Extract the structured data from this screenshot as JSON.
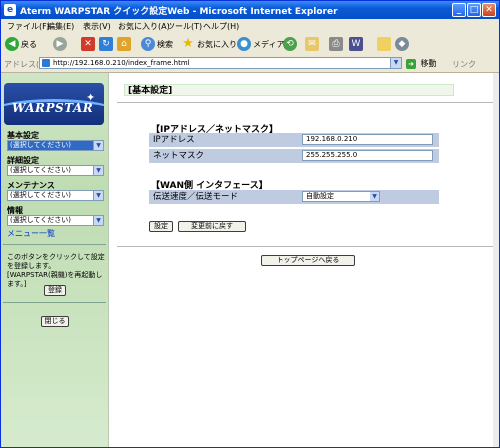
{
  "window": {
    "title": "Aterm WARPSTAR クイック設定Web - Microsoft Internet Explorer",
    "app_icon": "e",
    "minimize": "_",
    "maximize": "□",
    "close": "✕"
  },
  "menu": [
    "ファイル(F)",
    "編集(E)",
    "表示(V)",
    "お気に入り(A)",
    "ツール(T)",
    "ヘルプ(H)"
  ],
  "toolbar": {
    "back": "戻る",
    "search": "検索",
    "favorites": "お気に入り",
    "media": "メディア"
  },
  "address": {
    "label": "アドレス(D)",
    "url": "http://192.168.0.210/index_frame.html",
    "go": "移動",
    "links": "リンク"
  },
  "sidebar": {
    "logo": "WARPSTAR",
    "categories": [
      {
        "label": "基本設定",
        "select": "(選択してください)"
      },
      {
        "label": "詳細設定",
        "select": "(選択してください)"
      },
      {
        "label": "メンテナンス",
        "select": "(選択してください)"
      },
      {
        "label": "情報",
        "select": "(選択してください)"
      }
    ],
    "menu_list": "メニュー一覧",
    "note": "このボタンをクリックして設定を登録します。[WARPSTAR(親機)を再起動します。]",
    "register_button": "登録",
    "close_button": "閉じる"
  },
  "main": {
    "heading": "[基本設定]",
    "ip_section": "【IPアドレス／ネットマスク】",
    "ip_label": "IPアドレス",
    "ip_value": "192.168.0.210",
    "mask_label": "ネットマスク",
    "mask_value": "255.255.255.0",
    "wan_section": "【WAN側 インタフェース】",
    "speed_label": "伝送速度／伝送モード",
    "speed_value": "自動設定",
    "set_button": "設定",
    "revert_button": "変更前に戻す",
    "top_button": "トップページへ戻る"
  }
}
